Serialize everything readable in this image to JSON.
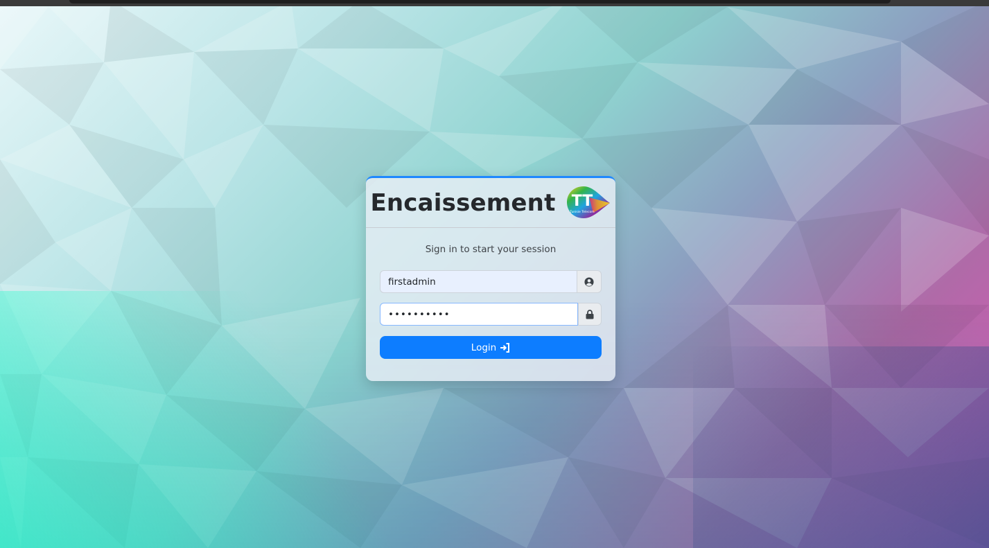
{
  "brand": {
    "title": "Encaissement",
    "logo_text": "TT",
    "logo_caption": "Tunisie Telecom"
  },
  "form": {
    "subtitle": "Sign in to start your session",
    "username_value": "firstadmin",
    "password_value": "••••••••••",
    "login_label": "Login"
  },
  "icons": {
    "username": "user-circle-icon",
    "password": "lock-icon",
    "login": "sign-in-arrow-icon"
  },
  "colors": {
    "accent": "#0d7dff",
    "card_border_top": "#1e88ff"
  }
}
